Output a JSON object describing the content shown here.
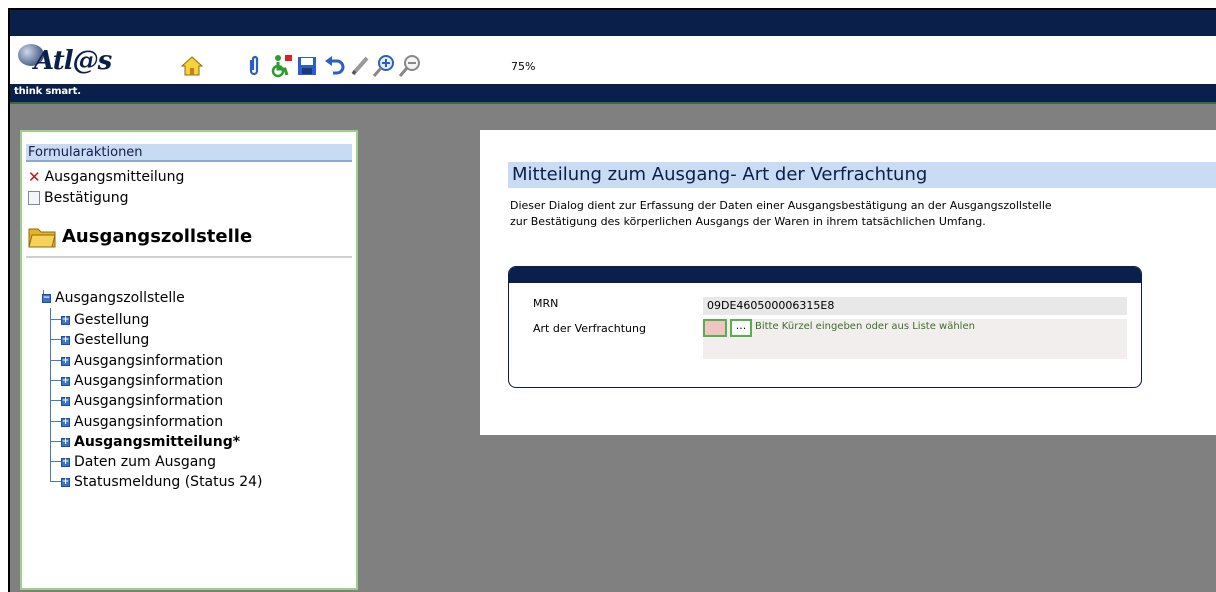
{
  "app": {
    "logo_text": "Atl@s",
    "tagline": "think smart.",
    "zoom": "75%"
  },
  "toolbar": {
    "icons": [
      "home-icon",
      "attachment-icon",
      "accessibility-icon",
      "save-icon",
      "undo-icon",
      "pencil-icon",
      "zoom-in-icon",
      "zoom-out-icon"
    ]
  },
  "sidebar": {
    "header": "Formularaktionen",
    "actions": [
      {
        "label": "Ausgangsmitteilung",
        "icon": "close-x-icon"
      },
      {
        "label": "Bestätigung",
        "icon": "document-icon"
      }
    ],
    "section_title": "Ausgangszollstelle",
    "tree_root": "Ausgangszollstelle",
    "tree_items": [
      {
        "label": "Gestellung",
        "bold": false
      },
      {
        "label": "Gestellung",
        "bold": false
      },
      {
        "label": "Ausgangsinformation",
        "bold": false
      },
      {
        "label": "Ausgangsinformation",
        "bold": false
      },
      {
        "label": "Ausgangsinformation",
        "bold": false
      },
      {
        "label": "Ausgangsinformation",
        "bold": false
      },
      {
        "label": "Ausgangsmitteilung*",
        "bold": true
      },
      {
        "label": "Daten zum Ausgang",
        "bold": false
      },
      {
        "label": "Statusmeldung (Status 24)",
        "bold": false
      }
    ]
  },
  "main": {
    "title": "Mitteilung zum Ausgang- Art der Verfrachtung",
    "description_line1": "Dieser Dialog dient zur Erfassung der Daten einer Ausgangsbestätigung an der Ausgangszollstelle",
    "description_line2": "zur Bestätigung des körperlichen Ausgangs der Waren in ihrem tatsächlichen Umfang.",
    "fields": {
      "mrn_label": "MRN",
      "mrn_value": "09DE460500006315E8",
      "art_label": "Art der Verfrachtung",
      "art_value": "",
      "art_button": "...",
      "art_hint": "Bitte Kürzel eingeben oder aus Liste wählen"
    }
  },
  "colors": {
    "navy": "#0a1f4a",
    "panel_border": "#9fd08a",
    "title_bg": "#c9dcf3",
    "field_green": "#58b04a",
    "input_pink": "#f1c4c4"
  }
}
